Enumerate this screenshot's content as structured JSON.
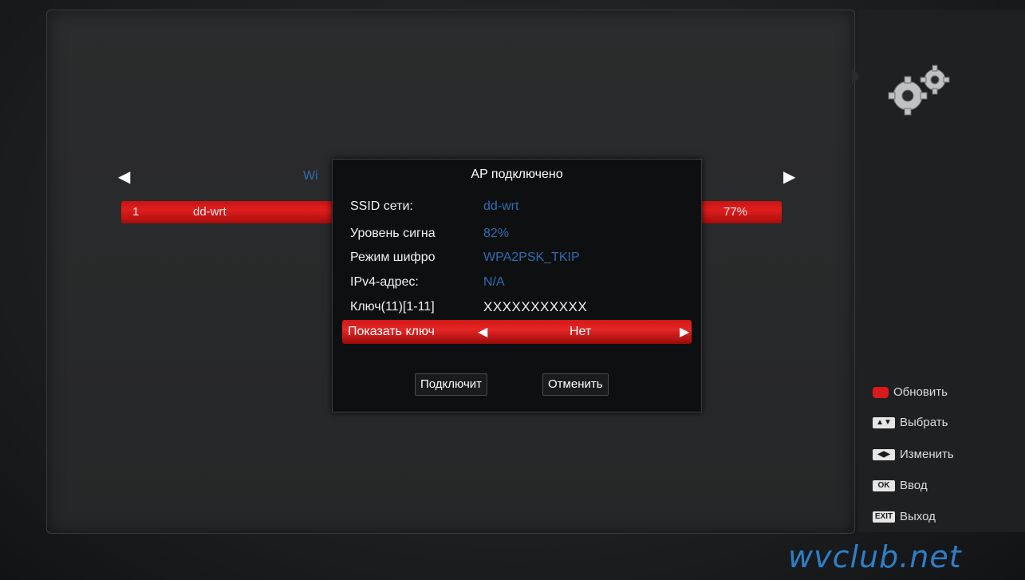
{
  "list": {
    "title": "Wi",
    "rows": [
      {
        "index": "1",
        "ssid": "dd-wrt",
        "signal": "77%"
      }
    ]
  },
  "dialog": {
    "title": "AP подключено",
    "fields": [
      {
        "label": "SSID сети:",
        "value": "dd-wrt"
      },
      {
        "label": "Уровень сигна",
        "value": "82%"
      },
      {
        "label": "Режим шифро",
        "value": "WPA2PSK_TKIP"
      },
      {
        "label": "IPv4-адрес:",
        "value": "N/A"
      },
      {
        "label": "Ключ(11)[1-11]",
        "value": "XXXXXXXXXXX"
      }
    ],
    "show_key": {
      "label": "Показать ключ",
      "value": "Нет"
    },
    "connect_label": "Подключит",
    "cancel_label": "Отменить"
  },
  "legend": [
    {
      "key": "",
      "label": "Обновить",
      "icon": "red-button"
    },
    {
      "key": "▲▼",
      "label": "Выбрать",
      "icon": "up-down-key"
    },
    {
      "key": "◀▶",
      "label": "Изменить",
      "icon": "left-right-key"
    },
    {
      "key": "OK",
      "label": "Ввод",
      "icon": "ok-key"
    },
    {
      "key": "EXIT",
      "label": "Выход",
      "icon": "exit-key"
    }
  ],
  "watermark": "wvclub.net",
  "colors": {
    "accent_red": "#e01e1e",
    "value_blue": "#2f6db0",
    "background": "#1e1f20"
  }
}
